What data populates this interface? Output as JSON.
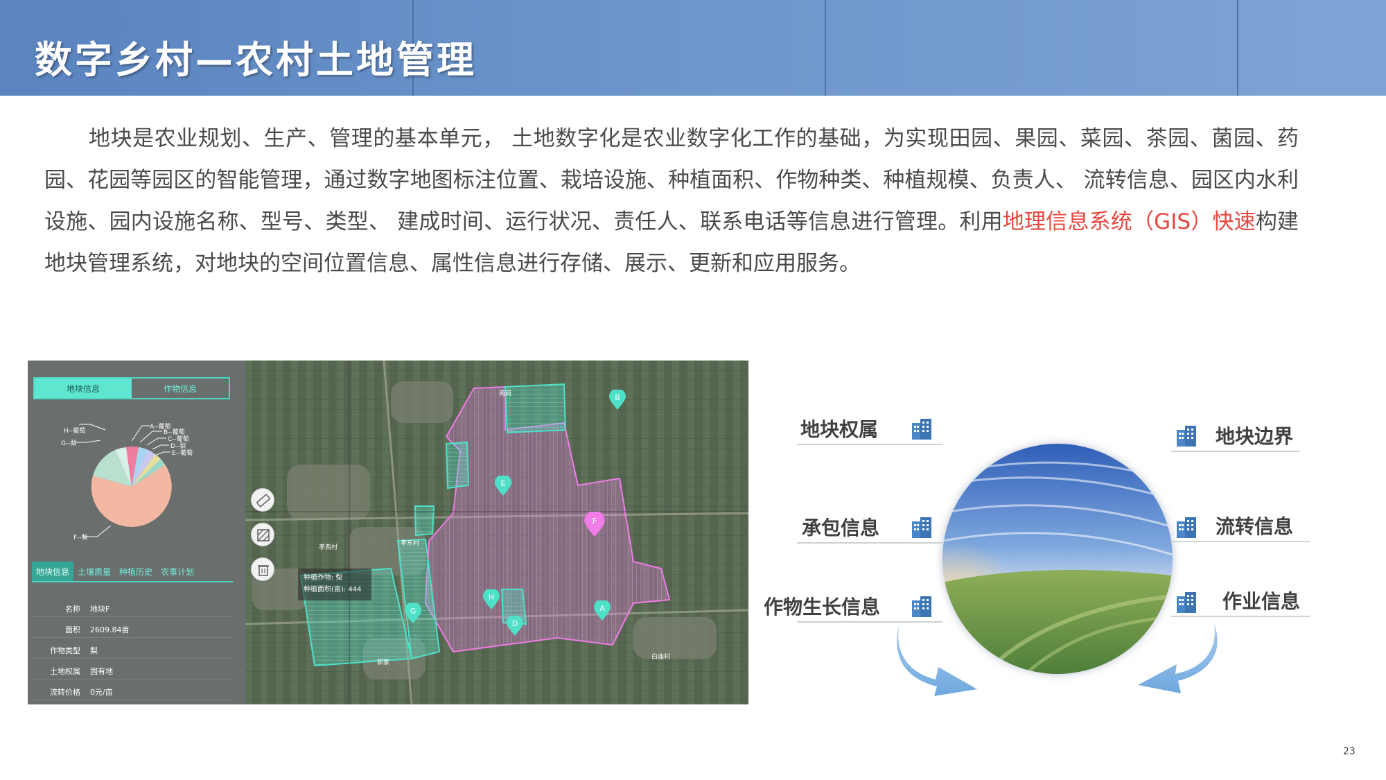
{
  "header": {
    "title": "数字乡村—农村土地管理"
  },
  "intro": {
    "part1": "地块是农业规划、生产、管理的基本单元， 土地数字化是农业数字化工作的基础，为实现田园、果园、菜园、茶园、菌园、药园、花园等园区的智能管理，通过数字地图标注位置、栽培设施、种植面积、作物种类、种植规模、负责人、 流转信息、园区内水利设施、园内设施名称、型号、类型、 建成时间、运行状况、责任人、联系电话等信息进行管理。利用",
    "highlight": "地理信息系统（GIS）快速",
    "part2": "构建地块管理系统，对地块的空间位置信息、属性信息进行存储、展示、更新和应用服务。"
  },
  "map_app": {
    "tabs": [
      "地块信息",
      "作物信息"
    ],
    "pie_labels": [
      "H--葡萄",
      "G--梨",
      "A--葡萄",
      "B--葡萄",
      "C--葡萄",
      "D--梨",
      "E--葡萄",
      "F--梨"
    ],
    "subtabs": [
      "地块信息",
      "土壤质量",
      "种植历史",
      "农事计划"
    ],
    "info_rows": [
      {
        "key": "名称",
        "value": "地块F"
      },
      {
        "key": "面积",
        "value": "2609.84亩"
      },
      {
        "key": "作物类型",
        "value": "梨"
      },
      {
        "key": "土地权属",
        "value": "国有地"
      },
      {
        "key": "流转价格",
        "value": "0元/亩"
      }
    ],
    "tooltip": {
      "line1": "种植作物:   梨",
      "line2": "种植面积(亩): 444"
    },
    "markers": [
      "B",
      "E",
      "F",
      "G",
      "H",
      "D",
      "A"
    ],
    "villages": [
      "南岗",
      "孝西村",
      "孝东村",
      "郭家",
      "白庙村"
    ],
    "tools": [
      "ruler-icon",
      "hatch-icon",
      "trash-icon"
    ],
    "colors": {
      "panel": "#6a6e6c",
      "accent": "#4fd6c3",
      "parcel_pink": "#f07ce8",
      "parcel_teal": "#4fe0c8"
    }
  },
  "diagram": {
    "left_labels": [
      "地块权属",
      "承包信息",
      "作物生长信息"
    ],
    "right_labels": [
      "地块边界",
      "流转信息",
      "作业信息"
    ],
    "icon": "building-icon",
    "colors": {
      "icon": "#4a86c8",
      "arrow": "#7db4e6"
    }
  },
  "page_number": "23"
}
